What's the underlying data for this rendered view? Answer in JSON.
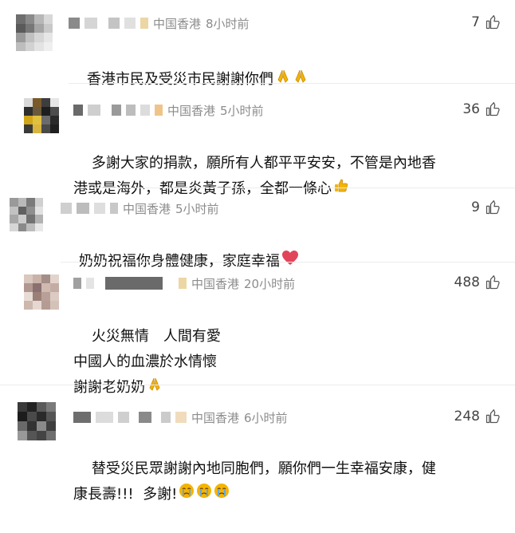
{
  "comments": [
    {
      "location": "中国香港",
      "time": "8小时前",
      "likes": "7",
      "text": "香港市民及受災市民謝謝你們",
      "emoji": [
        "praying-hands",
        "praying-hands"
      ]
    },
    {
      "location": "中国香港",
      "time": "5小时前",
      "likes": "36",
      "text": "多謝大家的捐款，願所有人都平平安安，不管是內地香\n港或是海外，都是炎黃子孫，全都一條心",
      "emoji": [
        "thumbs-up"
      ]
    },
    {
      "location": "中国香港",
      "time": "5小时前",
      "likes": "9",
      "text": "奶奶祝福你身體健康，家庭幸福",
      "emoji": [
        "heart"
      ]
    },
    {
      "location": "中国香港",
      "time": "20小时前",
      "likes": "488",
      "text": "火災無情　人間有愛\n中國人的血濃於水情懷\n謝謝老奶奶",
      "emoji": [
        "praying-hands"
      ]
    },
    {
      "location": "中国香港",
      "time": "6小时前",
      "likes": "248",
      "text": "替受災民眾謝謝內地同胞們，願你們一生幸福安康，健\n康長壽!!!  多謝!",
      "emoji": [
        "crying-face",
        "crying-face",
        "crying-face"
      ]
    }
  ],
  "colors": {
    "meta_gray": "#8c8c8c",
    "heart": "#e0455a",
    "emoji_yellow": "#f4b400"
  },
  "icons": {
    "like": "thumbs-up-outline-icon"
  }
}
